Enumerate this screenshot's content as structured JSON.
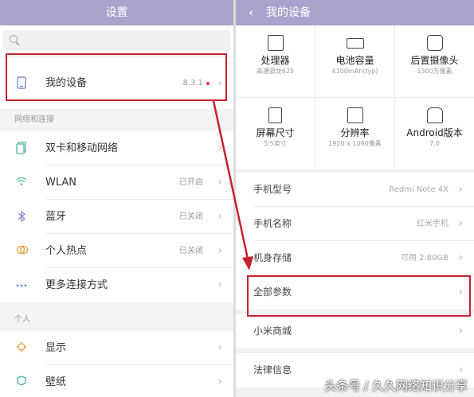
{
  "left": {
    "title": "设置",
    "search": {
      "placeholder": ""
    },
    "device": {
      "label": "我的设备",
      "value": "8.3.1",
      "icon": "phone-icon"
    },
    "section_network": "网络和连接",
    "network_items": [
      {
        "label": "双卡和移动网络",
        "value": "",
        "icon": "sim-icon"
      },
      {
        "label": "WLAN",
        "value": "已开启",
        "icon": "wifi-icon"
      },
      {
        "label": "蓝牙",
        "value": "已关闭",
        "icon": "bluetooth-icon"
      },
      {
        "label": "个人热点",
        "value": "已关闭",
        "icon": "hotspot-icon"
      },
      {
        "label": "更多连接方式",
        "value": "",
        "icon": "more-icon"
      }
    ],
    "section_personal": "个人",
    "personal_items": [
      {
        "label": "显示",
        "value": "",
        "icon": "brightness-icon"
      },
      {
        "label": "壁纸",
        "value": "",
        "icon": "wallpaper-icon"
      }
    ]
  },
  "right": {
    "title": "我的设备",
    "specs": [
      {
        "title": "处理器",
        "sub": "高通骁龙625",
        "icon": "cpu-icon"
      },
      {
        "title": "电池容量",
        "sub": "4100mAh(typ)",
        "icon": "battery-icon"
      },
      {
        "title": "后置摄像头",
        "sub": "1300万像素",
        "icon": "camera-icon"
      },
      {
        "title": "屏幕尺寸",
        "sub": "5.5英寸",
        "icon": "screen-icon"
      },
      {
        "title": "分辨率",
        "sub": "1920 x 1080像素",
        "icon": "resolution-icon"
      },
      {
        "title": "Android版本",
        "sub": "7.0",
        "icon": "android-icon"
      }
    ],
    "info_rows": [
      {
        "label": "手机型号",
        "value": "Redmi Note 4X"
      },
      {
        "label": "手机名称",
        "value": "红米手机"
      },
      {
        "label": "机身存储",
        "value": "可用 2.80GB"
      },
      {
        "label": "全部参数",
        "value": ""
      },
      {
        "label": "小米商城",
        "value": ""
      },
      {
        "label": "法律信息",
        "value": ""
      }
    ]
  },
  "watermark": "头条号 / 久久网络知识分享",
  "colors": {
    "header": "#aaa3cc",
    "highlight": "#c8202f",
    "icon_accent": "#7b8bd8"
  }
}
